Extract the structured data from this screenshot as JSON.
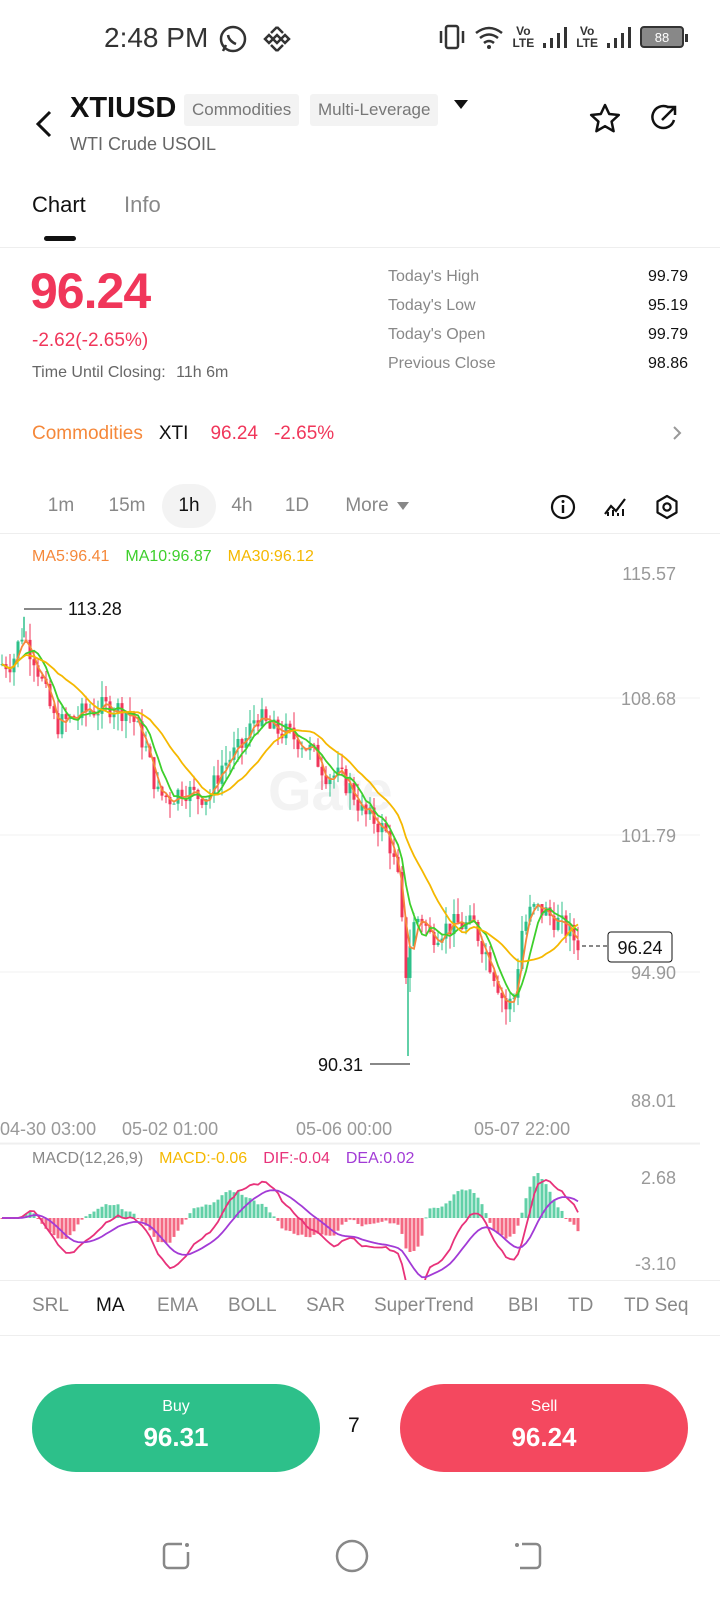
{
  "status": {
    "time": "2:48 PM",
    "battery": "88",
    "volte1": "Vo\nLTE",
    "volte2": "Vo\nLTE"
  },
  "header": {
    "symbol": "XTIUSD",
    "tag1": "Commodities",
    "tag2": "Multi-Leverage",
    "subtitle": "WTI Crude USOIL"
  },
  "tabs": {
    "chart": "Chart",
    "info": "Info"
  },
  "quote": {
    "price": "96.24",
    "change": "-2.62(-2.65%)",
    "closing_label": "Time Until Closing:",
    "closing_value": "11h 6m",
    "stats": [
      {
        "label": "Today's High",
        "value": "99.79"
      },
      {
        "label": "Today's Low",
        "value": "95.19"
      },
      {
        "label": "Today's Open",
        "value": "99.79"
      },
      {
        "label": "Previous Close",
        "value": "98.86"
      }
    ]
  },
  "related": {
    "category": "Commodities",
    "symbol": "XTI",
    "price": "96.24",
    "pct": "-2.65%"
  },
  "intervals": {
    "items": [
      "1m",
      "15m",
      "1h",
      "4h",
      "1D"
    ],
    "active": "1h",
    "more": "More"
  },
  "chart": {
    "ma5": "MA5:96.41",
    "ma10": "MA10:96.87",
    "ma30": "MA30:96.12",
    "y_ticks": [
      "115.57",
      "108.68",
      "101.79",
      "94.90",
      "88.01"
    ],
    "x_ticks": [
      "04-30 03:00",
      "05-02 01:00",
      "05-06 00:00",
      "05-07 22:00"
    ],
    "high_label": "113.28",
    "low_label": "90.31",
    "last_label": "96.24",
    "watermark": "Gate"
  },
  "macd": {
    "title": "MACD(12,26,9)",
    "macd": "MACD:-0.06",
    "dif": "DIF:-0.04",
    "dea": "DEA:0.02",
    "y_top": "2.68",
    "y_bottom": "-3.10"
  },
  "indicators": [
    "SRL",
    "MA",
    "EMA",
    "BOLL",
    "SAR",
    "SuperTrend",
    "BBI",
    "TD",
    "TD Seq"
  ],
  "active_indicator": "MA",
  "trade": {
    "buy_label": "Buy",
    "buy_price": "96.31",
    "spread": "7",
    "sell_label": "Sell",
    "sell_price": "96.24"
  },
  "colors": {
    "up": "#2dc08a",
    "down": "#f0365a",
    "ma5": "#f5883a",
    "ma10": "#3ecf2c",
    "ma30": "#f5b800",
    "dif": "#e8327a",
    "dea": "#a23bd6"
  }
}
